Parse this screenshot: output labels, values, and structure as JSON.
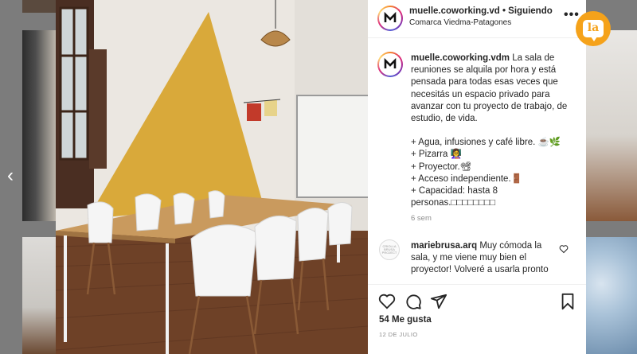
{
  "post": {
    "username": "muelle.coworking.vd",
    "follow_status": "• Siguiendo",
    "location": "Comarca Viedma-Patagones",
    "more_label": "•••"
  },
  "caption": {
    "username": "muelle.coworking.vdm",
    "intro": "La sala de reuniones se alquila por hora y está pensada para todas esas veces que necesitás un espacio privado para avanzar con tu proyecto de trabajo, de estudio, de vida.",
    "items": [
      "+ Agua, infusiones y café libre. ☕🌿",
      "+ Pizarra 👩‍🏫",
      "+ Proyector.📽",
      "+ Acceso independiente.🚪",
      "+ Capacidad: hasta 8 personas.□□□□□□□□"
    ],
    "time_ago": "6 sem"
  },
  "comment": {
    "avatar_text": "CRIOLLA BRUSA PROJECT",
    "username": "mariebrusa.arq",
    "text": "Muy cómoda la sala, y me viene muy bien el proyector! Volveré a usarla pronto"
  },
  "actions": {
    "likes": "54 Me gusta",
    "date": "12 DE JULIO"
  },
  "badge": {
    "label": "la",
    "color": "#f5a21a"
  },
  "nav": {
    "prev_glyph": "‹"
  }
}
